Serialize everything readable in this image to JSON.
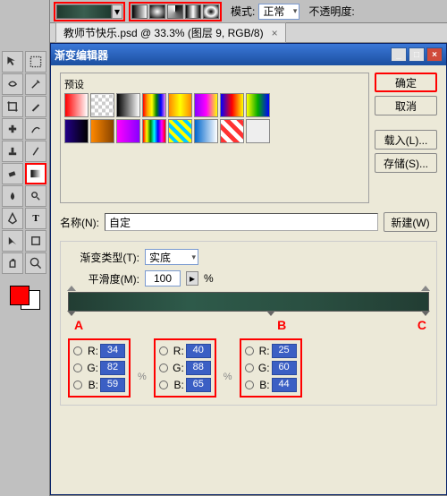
{
  "topbar": {
    "mode_label": "模式:",
    "mode_value": "正常",
    "opacity_label": "不透明度:"
  },
  "doc_tab": {
    "title": "教师节快乐.psd @ 33.3% (图层 9, RGB/8)"
  },
  "dialog": {
    "title": "渐变编辑器",
    "presets_label": "预设",
    "ok": "确定",
    "cancel": "取消",
    "load": "载入(L)...",
    "save": "存储(S)...",
    "name_label": "名称(N):",
    "name_value": "自定",
    "new_btn": "新建(W)",
    "type_label": "渐变类型(T):",
    "type_value": "实底",
    "smooth_label": "平滑度(M):",
    "smooth_value": "100",
    "pct": "%"
  },
  "markers": {
    "a": "A",
    "b": "B",
    "c": "C"
  },
  "rgb": {
    "a": {
      "r": "34",
      "g": "82",
      "b": "59"
    },
    "b": {
      "r": "40",
      "g": "88",
      "b": "65"
    },
    "c": {
      "r": "25",
      "g": "60",
      "b": "44"
    }
  },
  "labels": {
    "r": "R:",
    "g": "G:",
    "b": "B:"
  }
}
